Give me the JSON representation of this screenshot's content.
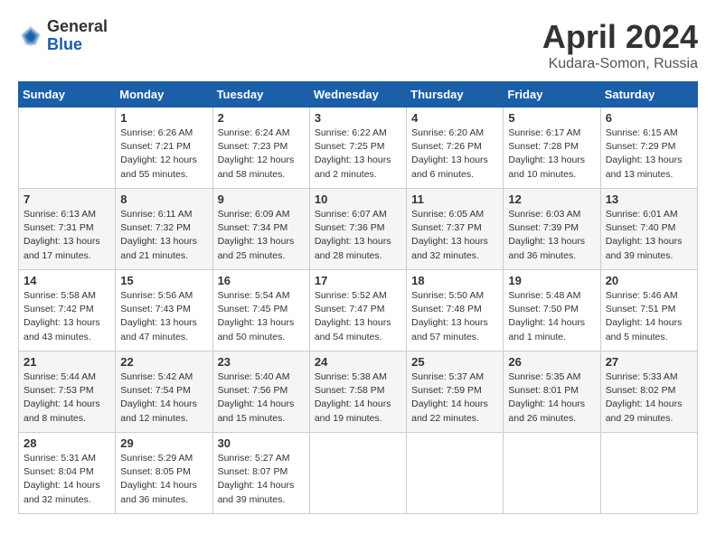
{
  "header": {
    "logo_general": "General",
    "logo_blue": "Blue",
    "title": "April 2024",
    "location": "Kudara-Somon, Russia"
  },
  "days_of_week": [
    "Sunday",
    "Monday",
    "Tuesday",
    "Wednesday",
    "Thursday",
    "Friday",
    "Saturday"
  ],
  "weeks": [
    [
      {
        "day": "",
        "info": ""
      },
      {
        "day": "1",
        "info": "Sunrise: 6:26 AM\nSunset: 7:21 PM\nDaylight: 12 hours\nand 55 minutes."
      },
      {
        "day": "2",
        "info": "Sunrise: 6:24 AM\nSunset: 7:23 PM\nDaylight: 12 hours\nand 58 minutes."
      },
      {
        "day": "3",
        "info": "Sunrise: 6:22 AM\nSunset: 7:25 PM\nDaylight: 13 hours\nand 2 minutes."
      },
      {
        "day": "4",
        "info": "Sunrise: 6:20 AM\nSunset: 7:26 PM\nDaylight: 13 hours\nand 6 minutes."
      },
      {
        "day": "5",
        "info": "Sunrise: 6:17 AM\nSunset: 7:28 PM\nDaylight: 13 hours\nand 10 minutes."
      },
      {
        "day": "6",
        "info": "Sunrise: 6:15 AM\nSunset: 7:29 PM\nDaylight: 13 hours\nand 13 minutes."
      }
    ],
    [
      {
        "day": "7",
        "info": "Sunrise: 6:13 AM\nSunset: 7:31 PM\nDaylight: 13 hours\nand 17 minutes."
      },
      {
        "day": "8",
        "info": "Sunrise: 6:11 AM\nSunset: 7:32 PM\nDaylight: 13 hours\nand 21 minutes."
      },
      {
        "day": "9",
        "info": "Sunrise: 6:09 AM\nSunset: 7:34 PM\nDaylight: 13 hours\nand 25 minutes."
      },
      {
        "day": "10",
        "info": "Sunrise: 6:07 AM\nSunset: 7:36 PM\nDaylight: 13 hours\nand 28 minutes."
      },
      {
        "day": "11",
        "info": "Sunrise: 6:05 AM\nSunset: 7:37 PM\nDaylight: 13 hours\nand 32 minutes."
      },
      {
        "day": "12",
        "info": "Sunrise: 6:03 AM\nSunset: 7:39 PM\nDaylight: 13 hours\nand 36 minutes."
      },
      {
        "day": "13",
        "info": "Sunrise: 6:01 AM\nSunset: 7:40 PM\nDaylight: 13 hours\nand 39 minutes."
      }
    ],
    [
      {
        "day": "14",
        "info": "Sunrise: 5:58 AM\nSunset: 7:42 PM\nDaylight: 13 hours\nand 43 minutes."
      },
      {
        "day": "15",
        "info": "Sunrise: 5:56 AM\nSunset: 7:43 PM\nDaylight: 13 hours\nand 47 minutes."
      },
      {
        "day": "16",
        "info": "Sunrise: 5:54 AM\nSunset: 7:45 PM\nDaylight: 13 hours\nand 50 minutes."
      },
      {
        "day": "17",
        "info": "Sunrise: 5:52 AM\nSunset: 7:47 PM\nDaylight: 13 hours\nand 54 minutes."
      },
      {
        "day": "18",
        "info": "Sunrise: 5:50 AM\nSunset: 7:48 PM\nDaylight: 13 hours\nand 57 minutes."
      },
      {
        "day": "19",
        "info": "Sunrise: 5:48 AM\nSunset: 7:50 PM\nDaylight: 14 hours\nand 1 minute."
      },
      {
        "day": "20",
        "info": "Sunrise: 5:46 AM\nSunset: 7:51 PM\nDaylight: 14 hours\nand 5 minutes."
      }
    ],
    [
      {
        "day": "21",
        "info": "Sunrise: 5:44 AM\nSunset: 7:53 PM\nDaylight: 14 hours\nand 8 minutes."
      },
      {
        "day": "22",
        "info": "Sunrise: 5:42 AM\nSunset: 7:54 PM\nDaylight: 14 hours\nand 12 minutes."
      },
      {
        "day": "23",
        "info": "Sunrise: 5:40 AM\nSunset: 7:56 PM\nDaylight: 14 hours\nand 15 minutes."
      },
      {
        "day": "24",
        "info": "Sunrise: 5:38 AM\nSunset: 7:58 PM\nDaylight: 14 hours\nand 19 minutes."
      },
      {
        "day": "25",
        "info": "Sunrise: 5:37 AM\nSunset: 7:59 PM\nDaylight: 14 hours\nand 22 minutes."
      },
      {
        "day": "26",
        "info": "Sunrise: 5:35 AM\nSunset: 8:01 PM\nDaylight: 14 hours\nand 26 minutes."
      },
      {
        "day": "27",
        "info": "Sunrise: 5:33 AM\nSunset: 8:02 PM\nDaylight: 14 hours\nand 29 minutes."
      }
    ],
    [
      {
        "day": "28",
        "info": "Sunrise: 5:31 AM\nSunset: 8:04 PM\nDaylight: 14 hours\nand 32 minutes."
      },
      {
        "day": "29",
        "info": "Sunrise: 5:29 AM\nSunset: 8:05 PM\nDaylight: 14 hours\nand 36 minutes."
      },
      {
        "day": "30",
        "info": "Sunrise: 5:27 AM\nSunset: 8:07 PM\nDaylight: 14 hours\nand 39 minutes."
      },
      {
        "day": "",
        "info": ""
      },
      {
        "day": "",
        "info": ""
      },
      {
        "day": "",
        "info": ""
      },
      {
        "day": "",
        "info": ""
      }
    ]
  ]
}
